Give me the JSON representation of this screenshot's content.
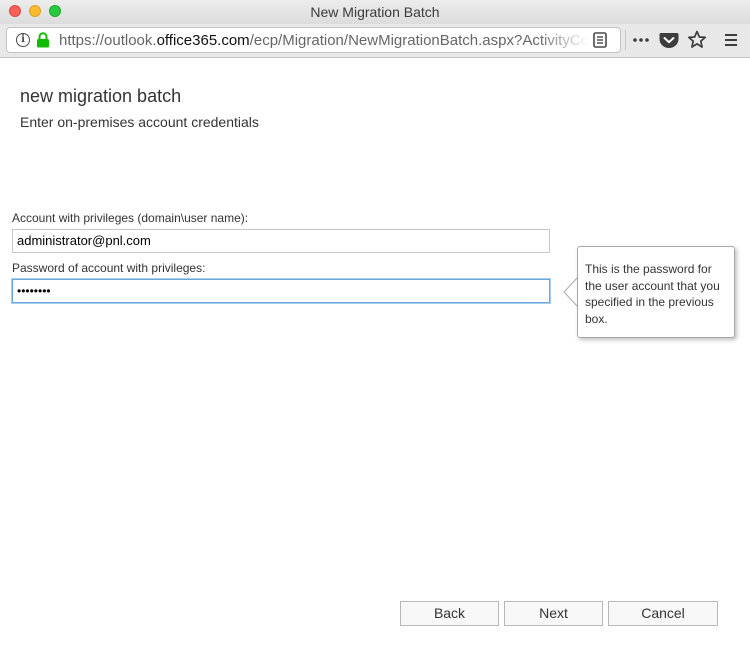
{
  "window": {
    "title": "New Migration Batch"
  },
  "browser": {
    "url_prefix": "https://outlook.",
    "url_domain": "office365.com",
    "url_suffix": "/ecp/Migration/NewMigrationBatch.aspx?ActivityCor"
  },
  "page": {
    "title": "new migration batch",
    "subtitle": "Enter on-premises account credentials"
  },
  "form": {
    "account_label": "Account with privileges (domain\\user name):",
    "account_value": "administrator@pnl.com",
    "password_label": "Password of account with privileges:",
    "password_mask": "••••••••"
  },
  "callout": {
    "text": "This is the password for the user account that you specified in the previous box."
  },
  "buttons": {
    "back": "Back",
    "next": "Next",
    "cancel": "Cancel"
  },
  "colors": {
    "lock_green": "#12bc00",
    "focus_blue": "#6aa6e0"
  }
}
